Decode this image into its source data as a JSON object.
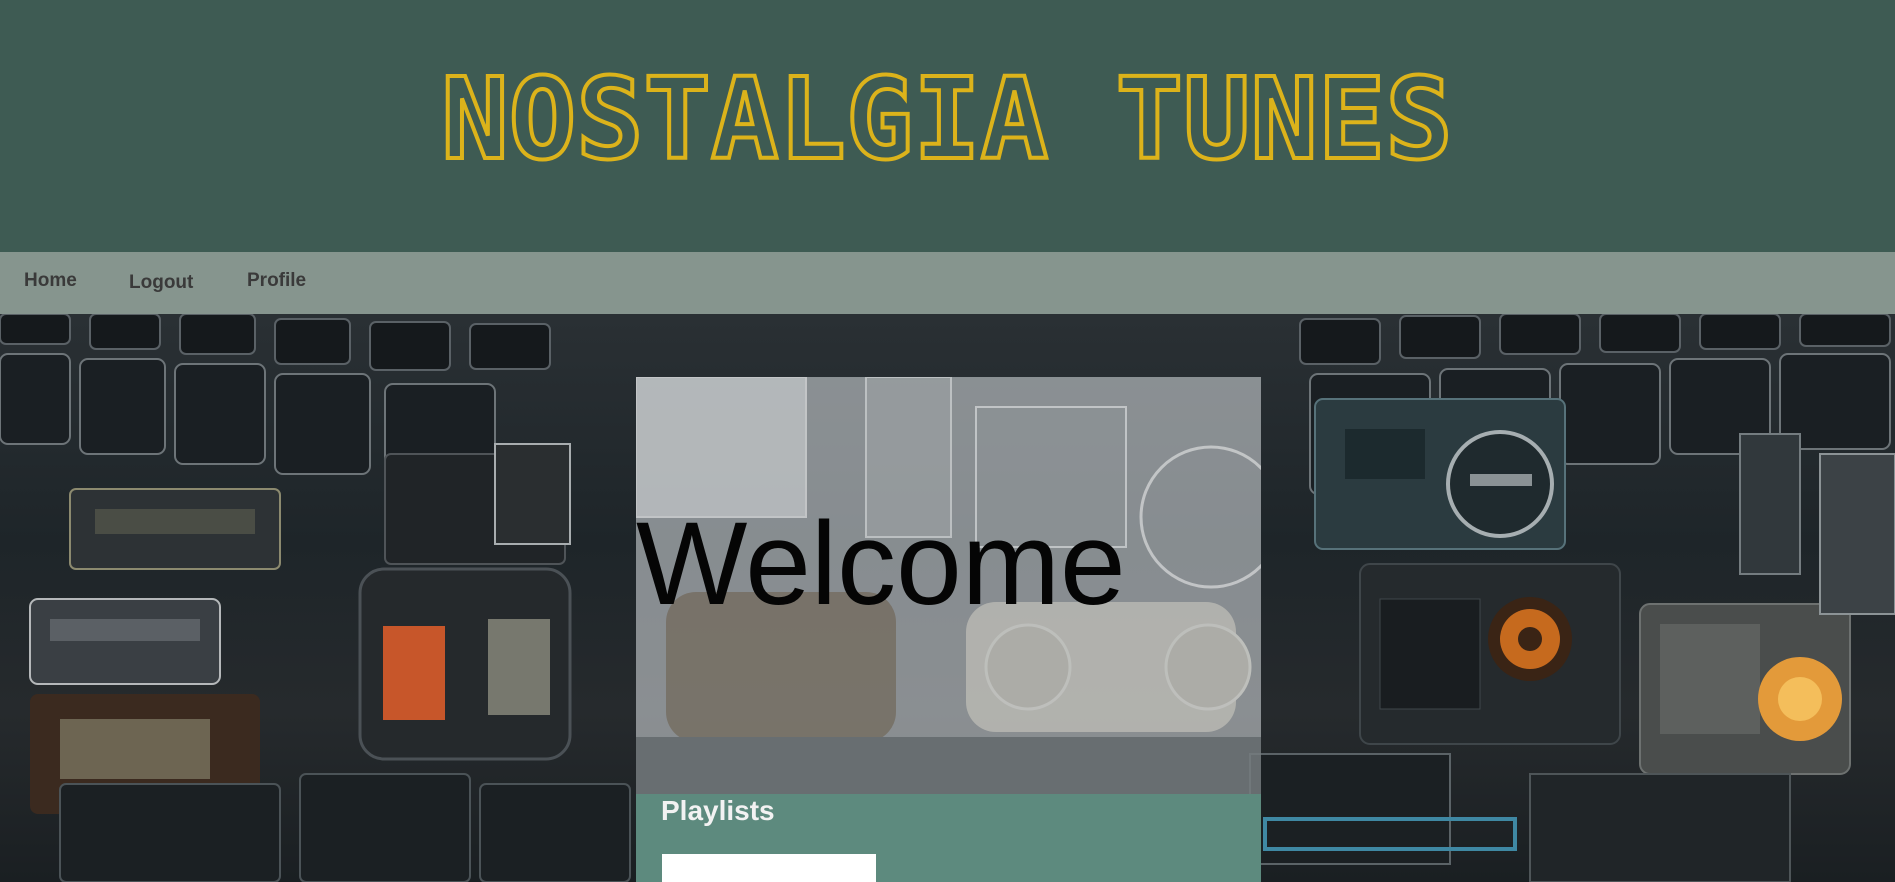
{
  "header": {
    "title": "NOSTALGIA TUNES"
  },
  "nav": {
    "items": [
      {
        "label": "Home"
      },
      {
        "label": "Logout"
      },
      {
        "label": "Profile"
      }
    ]
  },
  "main": {
    "welcome": "Welcome",
    "playlists_heading": "Playlists"
  },
  "colors": {
    "header_bg": "#3e5b53",
    "title_outline": "#dcb31b",
    "nav_bg": "#86958e",
    "card_overlay": "#c8cdd0",
    "playlists_bg": "#5d8a7e"
  },
  "background_image": "wall of vintage radios"
}
